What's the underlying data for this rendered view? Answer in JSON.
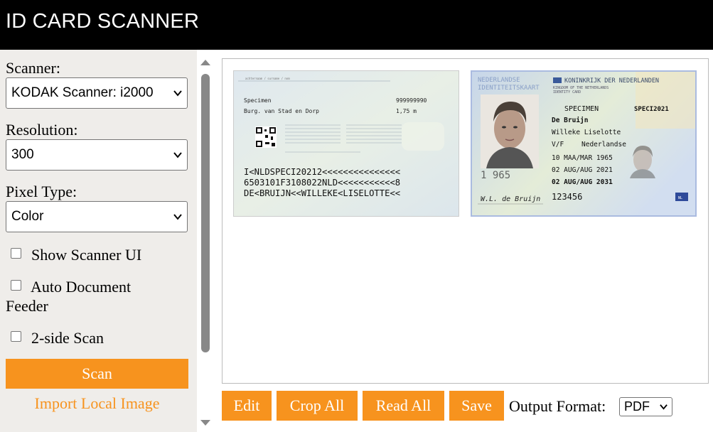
{
  "app": {
    "title": "ID CARD SCANNER"
  },
  "sidebar": {
    "scanner_label": "Scanner:",
    "scanner_value": "KODAK Scanner: i2000",
    "resolution_label": "Resolution:",
    "resolution_value": "300",
    "pixel_type_label": "Pixel Type:",
    "pixel_type_value": "Color",
    "show_ui_label": "Show Scanner UI",
    "adf_label_line1": "Auto Document",
    "adf_label_line2": "Feeder",
    "duplex_label": "2-side Scan",
    "scan_label": "Scan",
    "import_label": "Import Local Image"
  },
  "toolbar": {
    "edit_label": "Edit",
    "crop_all_label": "Crop All",
    "read_all_label": "Read All",
    "save_label": "Save",
    "output_format_label": "Output Format:",
    "output_format_value": "PDF"
  },
  "card_back": {
    "surname_caption": "achternaam / surname / nom",
    "name_value": "Specimen",
    "place_value": "Burg. van Stad en Dorp",
    "number_value": "999999990",
    "height_value": "1,75 m",
    "mrz_line1": "I<NLDSPECI20212<<<<<<<<<<<<<<<",
    "mrz_line2": "6503101F3108022NLD<<<<<<<<<<<8",
    "mrz_line3": "DE<BRUIJN<<WILLEKE<LISELOTTE<<"
  },
  "card_front": {
    "header_left_line1": "NEDERLANDSE",
    "header_left_line2": "IDENTITEITSKAART",
    "header_right_line1": "KONINKRIJK DER NEDERLANDEN",
    "header_right_line2": "KINGDOM OF THE NETHERLANDS",
    "header_right_line3": "IDENTITY CARD",
    "specimen_label": "SPECIMEN",
    "doc_number": "SPECI2021",
    "surname": "De Bruijn",
    "given_names": "Willeke Liselotte",
    "sex": "V/F",
    "nationality": "Nederlandse",
    "dob": "10 MAA/MAR 1965",
    "issue_date": "02 AUG/AUG 2021",
    "expiry_date": "02 AUG/AUG 2031",
    "card_number": "123456",
    "signature": "W.L. de Bruijn",
    "photo_number": "1 965",
    "eu_badge": "NL"
  },
  "colors": {
    "accent": "#f7931e",
    "header_bg": "#000000",
    "sidebar_bg": "#efedea"
  }
}
